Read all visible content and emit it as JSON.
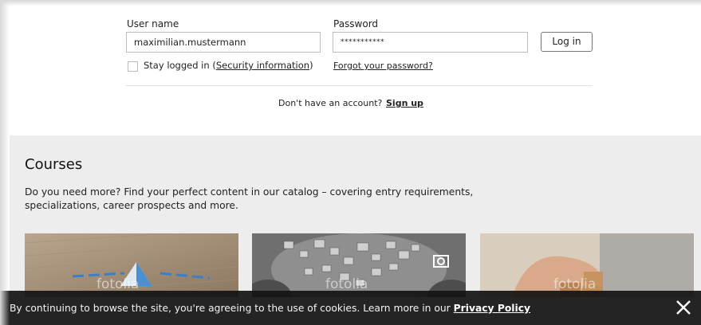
{
  "login": {
    "username_label": "User name",
    "username_value": "maximilian.mustermann",
    "password_label": "Password",
    "password_value": "***********",
    "login_button": "Log in",
    "stay_logged_in_prefix": "Stay logged in (",
    "security_link": "Security information",
    "stay_logged_in_suffix": ")",
    "forgot_link": "Forgot your password?",
    "no_account_text": "Don't have an account?",
    "signup_link": "Sign up"
  },
  "courses": {
    "title": "Courses",
    "description": "Do you need more? Find your perfect content in our catalog – covering entry requirements, specializations, career prospects and more.",
    "watermark": "fotolia",
    "cards": [
      {
        "icon": "paper-plane-image"
      },
      {
        "icon": "photo-cloud-image"
      },
      {
        "icon": "wooden-blocks-image"
      }
    ]
  },
  "cookie_banner": {
    "text": "By continuing to browse the site, you're agreeing to the use of cookies. Learn more in our ",
    "policy_link": "Privacy Policy",
    "close_icon": "close-icon"
  }
}
